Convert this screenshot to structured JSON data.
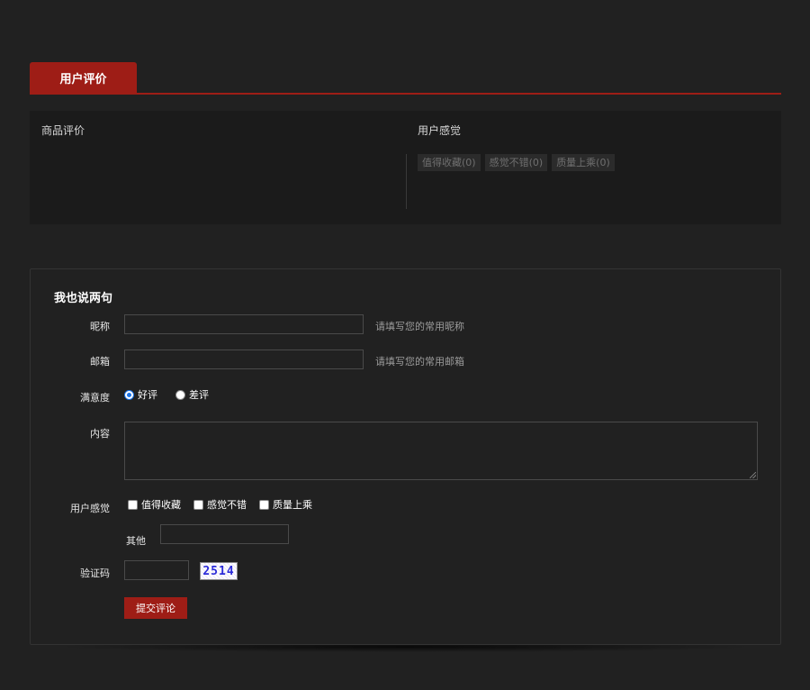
{
  "tabs": {
    "active_label": "用户评价"
  },
  "summary": {
    "product_review_title": "商品评价",
    "feel_title": "用户感觉",
    "feel_tags": [
      "值得收藏(0)",
      "感觉不错(0)",
      "质量上乘(0)"
    ]
  },
  "form": {
    "title": "我也说两句",
    "nickname_label": "昵称",
    "nickname_value": "",
    "nickname_hint": "请填写您的常用昵称",
    "email_label": "邮箱",
    "email_value": "",
    "email_hint": "请填写您的常用邮箱",
    "satisfaction_label": "满意度",
    "satisfaction_options": [
      "好评",
      "差评"
    ],
    "satisfaction_selected": "好评",
    "content_label": "内容",
    "content_value": "",
    "feel_label": "用户感觉",
    "feel_options": [
      "值得收藏",
      "感觉不错",
      "质量上乘"
    ],
    "other_label": "其他",
    "other_value": "",
    "captcha_label": "验证码",
    "captcha_value": "",
    "captcha_text": "2514",
    "submit_label": "提交评论"
  },
  "colors": {
    "background": "#212121",
    "panel": "#1b1b1b",
    "accent": "#9e1d16"
  }
}
